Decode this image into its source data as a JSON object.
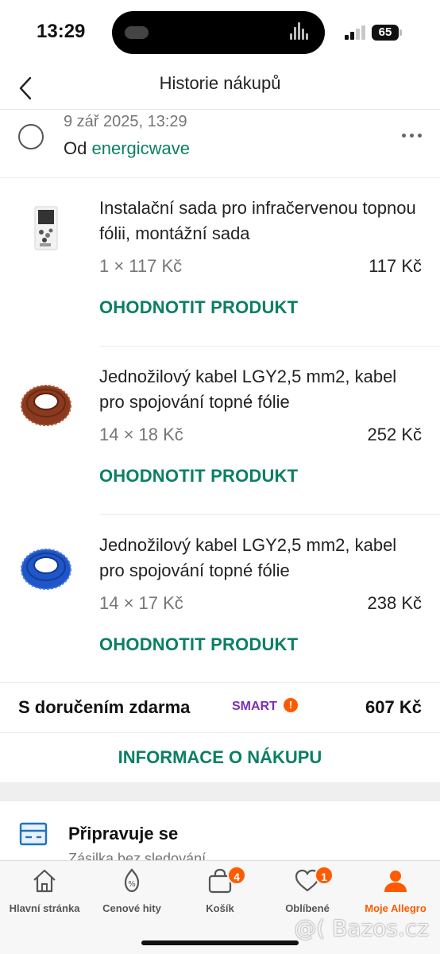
{
  "status_bar": {
    "time": "13:29",
    "battery": "65"
  },
  "header": {
    "title": "Historie nákupů"
  },
  "order": {
    "date": "9 zář 2025, 13:29",
    "from_prefix": "Od",
    "seller": "energicwave"
  },
  "products": [
    {
      "name": "Instalační sada pro infračervenou topnou fólii, montážní sada",
      "qty_price": "1 × 117 Kč",
      "total": "117 Kč",
      "rate_label": "OHODNOTIT PRODUKT"
    },
    {
      "name": "Jednožilový kabel LGY2,5 mm2, kabel pro spojování topné fólie",
      "qty_price": "14 × 18 Kč",
      "total": "252 Kč",
      "rate_label": "OHODNOTIT PRODUKT"
    },
    {
      "name": "Jednožilový kabel LGY2,5 mm2, kabel pro spojování topné fólie",
      "qty_price": "14 × 17 Kč",
      "total": "238 Kč",
      "rate_label": "OHODNOTIT PRODUKT"
    }
  ],
  "summary": {
    "label": "S doručením zdarma",
    "badge": "SMART",
    "badge_mark": "!",
    "total": "607 Kč"
  },
  "info_button": "INFORMACE O NÁKUPU",
  "shipment": {
    "status": "Připravuje se",
    "subtitle": "Zásilka bez sledování"
  },
  "tabs": [
    {
      "label": "Hlavní stránka",
      "icon": "home-icon"
    },
    {
      "label": "Cenové hity",
      "icon": "discount-tag-icon"
    },
    {
      "label": "Košík",
      "icon": "shopping-bag-icon",
      "badge": "4"
    },
    {
      "label": "Oblíbené",
      "icon": "heart-icon",
      "badge": "1"
    },
    {
      "label": "Moje Allegro",
      "icon": "user-icon",
      "active": true
    }
  ],
  "watermark": "@( Bazos.cz",
  "colors": {
    "accent_green": "#0b7f66",
    "brand_orange": "#ff5a00",
    "smart_purple": "#7a2fb8"
  }
}
